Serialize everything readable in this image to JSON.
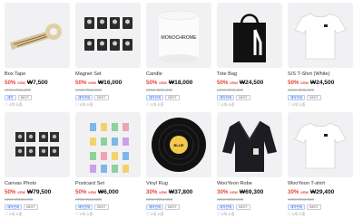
{
  "products": [
    {
      "name": "Box Tape",
      "discount": "50%",
      "currency": "KRW",
      "price": "₩7,500",
      "original": "KRW ₩15,000",
      "tags": [
        "예약",
        "BEST"
      ],
      "likes": "♡ 0개 소중"
    },
    {
      "name": "Magnet Set",
      "discount": "50%",
      "currency": "KRW",
      "price": "₩16,000",
      "original": "KRW ₩32,000",
      "tags": [
        "예약판매",
        "BEST"
      ],
      "likes": "♡ 0개 소중"
    },
    {
      "name": "Candle",
      "discount": "50%",
      "currency": "KRW",
      "price": "₩18,000",
      "original": "KRW ₩36,000",
      "tags": [
        "예약판매",
        "BEST"
      ],
      "likes": "♡ 0개 소중"
    },
    {
      "name": "Tote Bag",
      "discount": "50%",
      "currency": "KRW",
      "price": "₩24,500",
      "original": "KRW ₩49,000",
      "tags": [
        "예약판매",
        "BEST"
      ],
      "likes": "♡ 0개 소중"
    },
    {
      "name": "S/S T-Shirt (White)",
      "discount": "50%",
      "currency": "KRW",
      "price": "₩24,500",
      "original": "KRW ₩49,000",
      "tags": [
        "예약판매",
        "BEST"
      ],
      "likes": "♡ 0개 소중"
    },
    {
      "name": "Canvas Photo",
      "discount": "50%",
      "currency": "KRW",
      "price": "₩79,500",
      "original": "KRW ₩159,000",
      "tags": [
        "예약판매",
        "BEST"
      ],
      "likes": "♡ 0개 소중"
    },
    {
      "name": "Postcard Set",
      "discount": "50%",
      "currency": "KRW",
      "price": "₩6,000",
      "original": "KRW ₩12,000",
      "tags": [
        "예약판매",
        "BEST"
      ],
      "likes": "♡ 0개 소중"
    },
    {
      "name": "Vinyl Rug",
      "discount": "30%",
      "currency": "KRW",
      "price": "₩37,800",
      "original": "KRW ₩54,000",
      "tags": [
        "예약판매",
        "BEST"
      ],
      "likes": "♡ 0개 소중"
    },
    {
      "name": "WooYeon Robe",
      "discount": "30%",
      "currency": "KRW",
      "price": "₩69,300",
      "original": "KRW ₩99,000",
      "tags": [
        "예약판매",
        "BEST"
      ],
      "likes": "♡ 0개 소중"
    },
    {
      "name": "WooYeon T-shirt",
      "discount": "30%",
      "currency": "KRW",
      "price": "₩29,400",
      "original": "KRW ₩42,000",
      "tags": [
        "예약판매",
        "BEST"
      ],
      "likes": "♡ 0개 소중"
    }
  ],
  "thumb_text": {
    "candle_label": "MONOCHROME",
    "vinyl_label": "BLUE"
  },
  "colors": {
    "discount": "#e8443a",
    "tag_blue": "#3b6fe0",
    "thumb_bg": "#f1f1f3"
  },
  "icons": [
    "tape-icon",
    "photo-grid-icon",
    "candle-icon",
    "tote-bag-icon",
    "tshirt-icon",
    "canvas-photo-icon",
    "postcard-icon",
    "vinyl-rug-icon",
    "robe-icon",
    "tshirt-icon"
  ]
}
